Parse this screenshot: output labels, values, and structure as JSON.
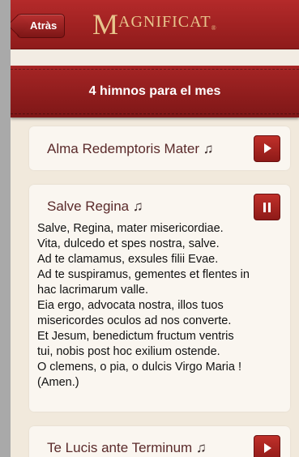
{
  "nav": {
    "back_label": "Atràs",
    "logo_initial": "M",
    "logo_rest": "AGNIFICAT",
    "logo_mark": "®"
  },
  "header": {
    "title": "4 himnos para el mes"
  },
  "hymns": [
    {
      "title": "Alma Redemptoris Mater",
      "note_icon": "♫",
      "control": "play-icon"
    },
    {
      "title": "Salve Regina",
      "note_icon": "♫",
      "control": "pause-icon",
      "lyrics": [
        "Salve, Regina, mater misericordiae.",
        "Vita, dulcedo et spes nostra, salve.",
        "Ad te clamamus, exsules filii Evae.",
        "Ad te suspiramus, gementes et flentes in",
        "hac lacrimarum valle.",
        "Eia ergo, advocata nostra, illos tuos",
        "misericordes oculos ad nos converte.",
        "Et Jesum, benedictum fructum ventris",
        "tui, nobis post hoc exilium ostende.",
        "O clemens, o pia, o dulcis Virgo Maria !",
        "(Amen.)"
      ]
    },
    {
      "title": "Te Lucis ante Terminum",
      "note_icon": "♫",
      "control": "play-icon"
    }
  ],
  "colors": {
    "accent": "#a62525",
    "logo_gold": "#e7c58c",
    "background": "#f1e9dc"
  }
}
